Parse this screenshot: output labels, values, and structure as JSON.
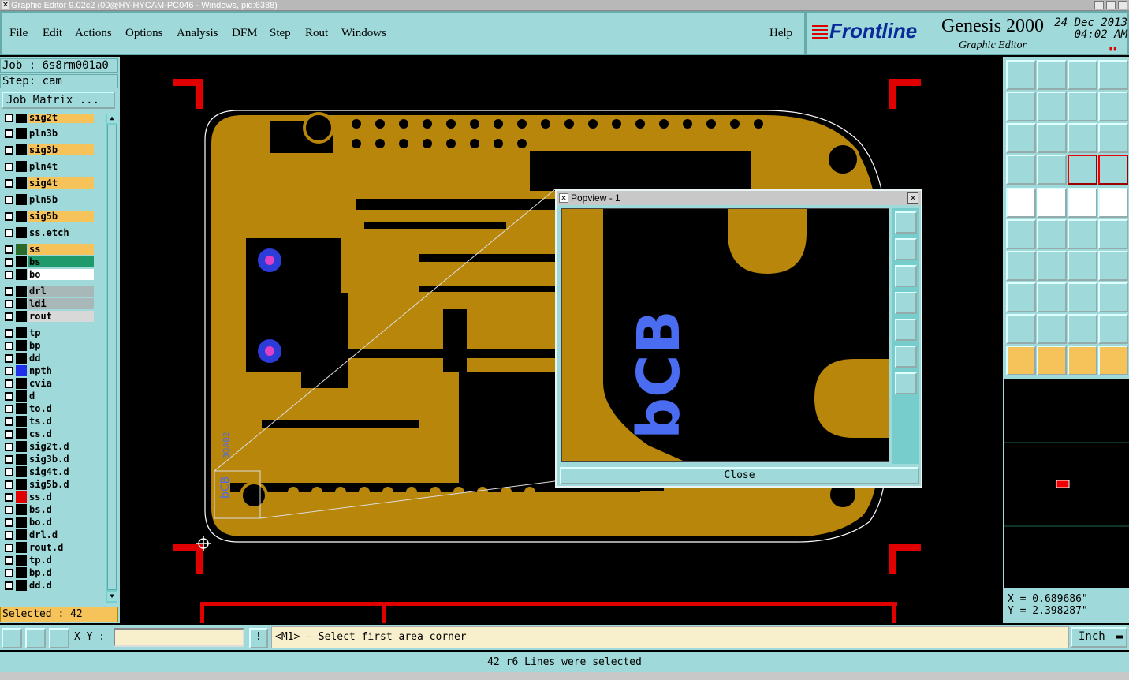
{
  "window": {
    "title": "Graphic Editor 9.02c2 (00@HY-HYCAM-PC046 - Windows, pid:6388)"
  },
  "menu": {
    "items": [
      "File",
      "Edit",
      "Actions",
      "Options",
      "Analysis",
      "DFM",
      "Step",
      "Rout",
      "Windows"
    ],
    "help": "Help"
  },
  "brand": {
    "logo": "Frontline",
    "product": "Genesis 2000",
    "subtitle": "Graphic Editor",
    "date": "24 Dec 2013",
    "time": "04:02 AM"
  },
  "left_panel": {
    "job": "Job : 6s8rm001a0",
    "step": "Step: cam",
    "job_matrix_button": "Job Matrix ...",
    "layers": [
      {
        "name": "sig2t",
        "color": "#f6c35a"
      },
      {
        "name": "pln3b",
        "color": "#9fd9d9"
      },
      {
        "name": "sig3b",
        "color": "#f6c35a"
      },
      {
        "name": "pln4t",
        "color": "#9fd9d9"
      },
      {
        "name": "sig4t",
        "color": "#f6c35a"
      },
      {
        "name": "pln5b",
        "color": "#9fd9d9"
      },
      {
        "name": "sig5b",
        "color": "#f6c35a"
      },
      {
        "name": "ss.etch",
        "color": "#9fd9d9"
      },
      {
        "name": "ss",
        "color": "#f6c35a"
      },
      {
        "name": "bs",
        "color": "#1f9a6a"
      },
      {
        "name": "bo",
        "color": "#ffffff"
      },
      {
        "name": "drl",
        "color": "#a8b8b8"
      },
      {
        "name": "ldi",
        "color": "#a8b8b8"
      },
      {
        "name": "rout",
        "color": "#d8d8d8"
      },
      {
        "name": "tp",
        "color": "#9fd9d9"
      },
      {
        "name": "bp",
        "color": "#9fd9d9"
      },
      {
        "name": "dd",
        "color": "#9fd9d9"
      },
      {
        "name": "npth",
        "color": "#9fd9d9"
      },
      {
        "name": "cvia",
        "color": "#9fd9d9"
      },
      {
        "name": "d",
        "color": "#9fd9d9"
      },
      {
        "name": "to.d",
        "color": "#9fd9d9"
      },
      {
        "name": "ts.d",
        "color": "#9fd9d9"
      },
      {
        "name": "cs.d",
        "color": "#9fd9d9"
      },
      {
        "name": "sig2t.d",
        "color": "#9fd9d9"
      },
      {
        "name": "sig3b.d",
        "color": "#9fd9d9"
      },
      {
        "name": "sig4t.d",
        "color": "#9fd9d9"
      },
      {
        "name": "sig5b.d",
        "color": "#9fd9d9"
      },
      {
        "name": "ss.d",
        "color": "#9fd9d9"
      },
      {
        "name": "bs.d",
        "color": "#9fd9d9"
      },
      {
        "name": "bo.d",
        "color": "#9fd9d9"
      },
      {
        "name": "drl.d",
        "color": "#9fd9d9"
      },
      {
        "name": "rout.d",
        "color": "#9fd9d9"
      },
      {
        "name": "tp.d",
        "color": "#9fd9d9"
      },
      {
        "name": "bp.d",
        "color": "#9fd9d9"
      },
      {
        "name": "dd.d",
        "color": "#9fd9d9"
      }
    ],
    "selected": "Selected : 42"
  },
  "canvas": {
    "board_color": "#b8860b",
    "silkscreen_text": "bCB",
    "silkscreen_text_2": "BGAB2",
    "frame_color": "#e00000"
  },
  "popview": {
    "title": "Popview - 1",
    "close_label": "Close",
    "text": "bCB"
  },
  "coords": {
    "x": "X = 0.689686\"",
    "y": "Y = 2.398287\""
  },
  "command_bar": {
    "xy_label": "X Y :",
    "xy_value": "",
    "prompt": "<M1> - Select first area corner",
    "units": "Inch"
  },
  "status": {
    "message": "42 r6 Lines were selected"
  }
}
